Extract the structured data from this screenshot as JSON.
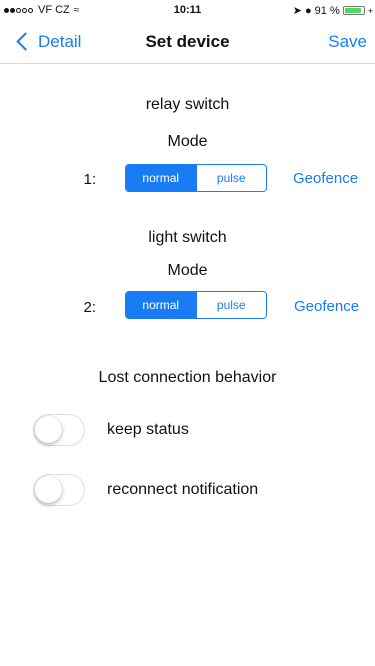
{
  "status_bar": {
    "carrier": "VF CZ",
    "wifi_icon": "wifi-icon",
    "time": "10:11",
    "location_icon": "location-arrow-icon",
    "alarm_icon": "alarm-icon",
    "battery_percent": "91 %",
    "battery_level": 0.91,
    "battery_color": "#4cd964"
  },
  "nav": {
    "back_label": "Detail",
    "title": "Set device",
    "save_label": "Save",
    "accent_color": "#1a7cf5"
  },
  "channels": [
    {
      "name": "relay switch",
      "mode_label": "Mode",
      "index_label": "1:",
      "options": [
        "normal",
        "pulse"
      ],
      "selected": "normal",
      "geofence_label": "Geofence"
    },
    {
      "name": "light switch",
      "mode_label": "Mode",
      "index_label": "2:",
      "options": [
        "normal",
        "pulse"
      ],
      "selected": "normal",
      "geofence_label": "Geofence"
    }
  ],
  "lost_connection": {
    "heading": "Lost connection behavior",
    "toggles": [
      {
        "label": "keep status",
        "on": false
      },
      {
        "label": "reconnect notification",
        "on": false
      }
    ]
  }
}
